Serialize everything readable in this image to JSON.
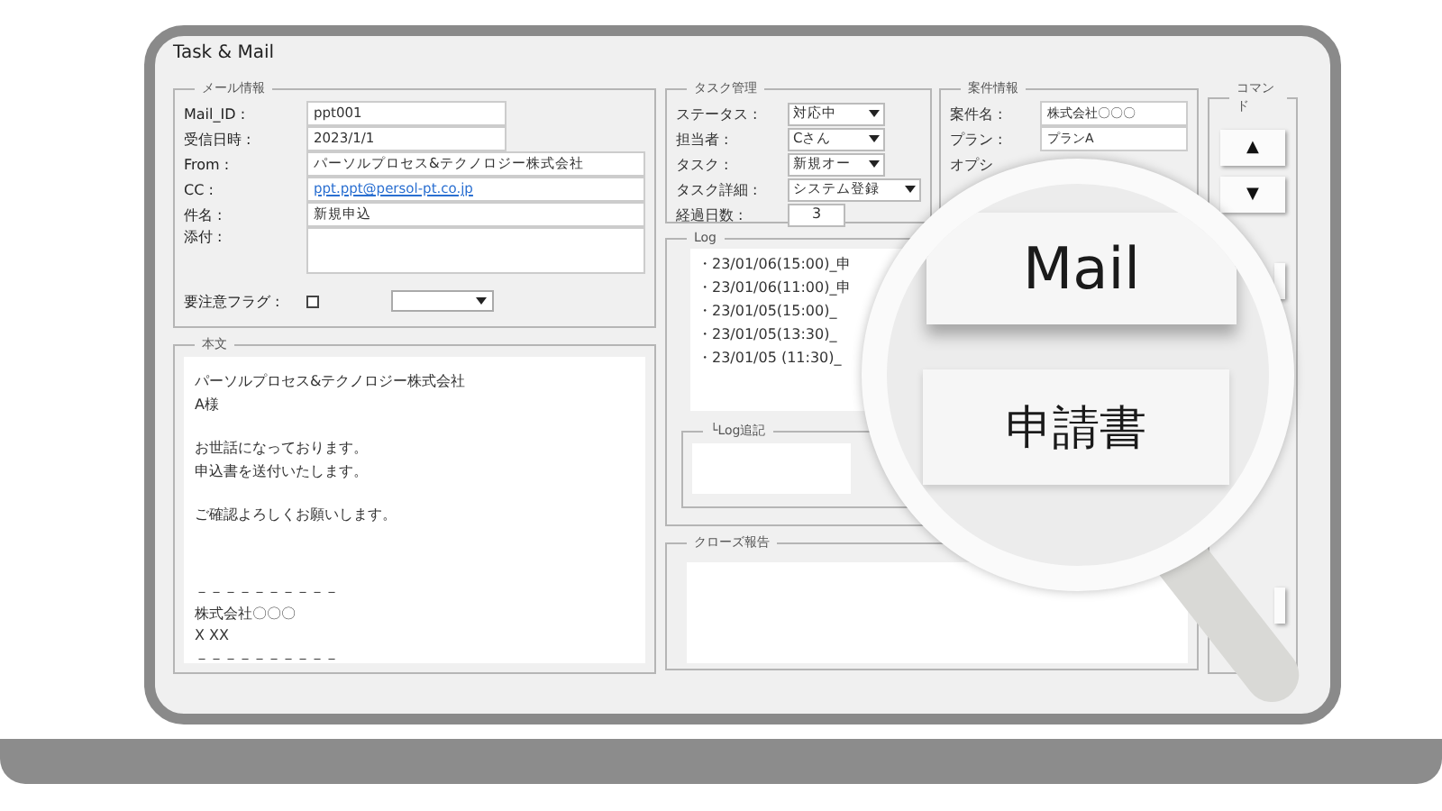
{
  "window": {
    "title": "Task & Mail"
  },
  "mail_info": {
    "legend": "メール情報",
    "fields": [
      {
        "label": "Mail_ID :",
        "value": "ppt001",
        "kind": "short"
      },
      {
        "label": "受信日時 :",
        "value": "2023/1/1",
        "kind": "short"
      },
      {
        "label": "From :",
        "value": "パーソルプロセス&テクノロジー株式会社",
        "kind": "text"
      },
      {
        "label": "CC :",
        "value": "ppt.ppt@persol-pt.co.jp",
        "kind": "link"
      },
      {
        "label": "件名 :",
        "value": "新規申込",
        "kind": "text"
      },
      {
        "label": "添付 :",
        "kind": "area"
      }
    ],
    "flag": {
      "label": "要注意フラグ :",
      "checked": false
    }
  },
  "body": {
    "legend": "本文",
    "paragraphs": [
      [
        "パーソルプロセス&テクノロジー株式会社",
        "A様"
      ],
      [
        "お世話になっております。",
        "申込書を送付いたします。"
      ],
      [
        "ご確認よろしくお願いします。"
      ],
      [
        "－－－－－－－－－－",
        "株式会社〇〇〇",
        "X XX",
        "－－－－－－－－－－"
      ]
    ]
  },
  "task": {
    "legend": "タスク管理",
    "fields": [
      {
        "label": "ステータス :",
        "value": "対応中",
        "kind": "select"
      },
      {
        "label": "担当者 :",
        "value": "Cさん",
        "kind": "select"
      },
      {
        "label": "タスク :",
        "value": "新規オー",
        "kind": "select"
      },
      {
        "label": "タスク詳細 :",
        "value": "システム登録",
        "kind": "select"
      },
      {
        "label": "経過日数 :",
        "value": "3",
        "kind": "number"
      }
    ]
  },
  "case_info": {
    "legend": "案件情報",
    "fields": [
      {
        "label": "案件名 :",
        "value": "株式会社〇〇〇"
      },
      {
        "label": "プラン :",
        "value": "プランA"
      },
      {
        "label": "オプシ"
      }
    ]
  },
  "log": {
    "legend": "Log",
    "entries": [
      "・23/01/06(15:00)_申",
      "・23/01/06(11:00)_申",
      "・23/01/05(15:00)_",
      "・23/01/05(13:30)_",
      "・23/01/05 (11:30)_"
    ],
    "append_legend": "└Log追記"
  },
  "close_report": {
    "legend": "クローズ報告"
  },
  "commands": {
    "legend": "コマンド",
    "buttons": [
      {
        "kind": "up",
        "label": "▲"
      },
      {
        "kind": "down",
        "label": "▼"
      },
      {
        "kind": "blank"
      },
      {
        "kind": "blank"
      }
    ]
  },
  "magnifier": {
    "buttons": [
      "Mail",
      "申請書"
    ]
  }
}
